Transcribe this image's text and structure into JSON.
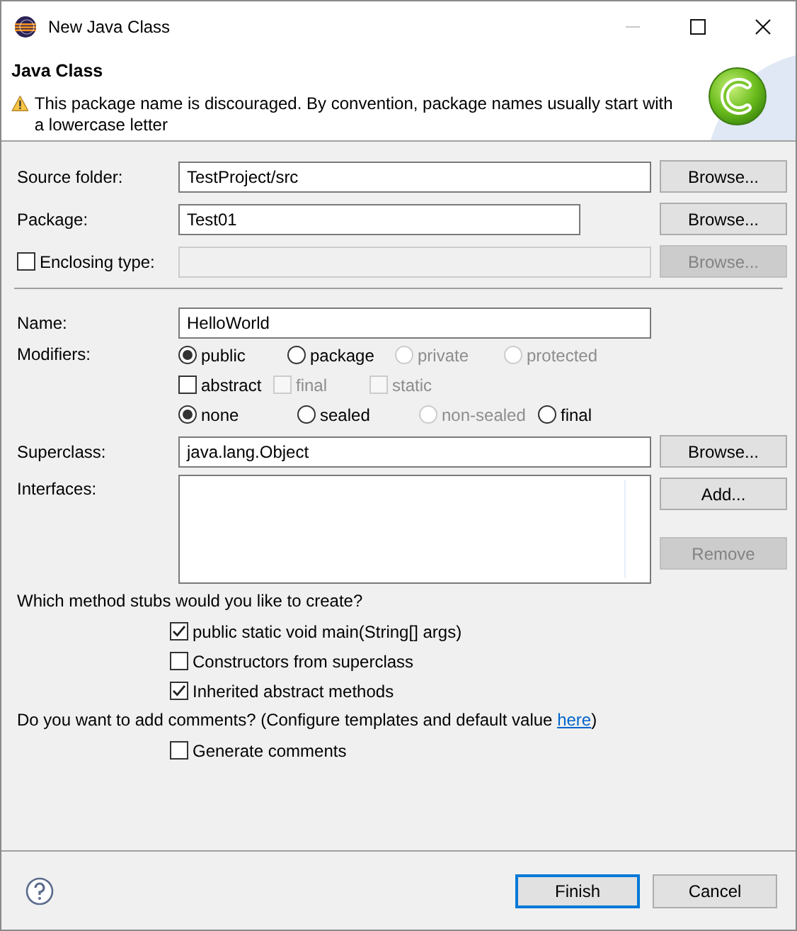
{
  "window": {
    "title": "New Java Class"
  },
  "header": {
    "title": "Java Class",
    "kind": "warning",
    "message": "This package name is discouraged. By convention, package names usually start with a lowercase letter"
  },
  "fields": [
    {
      "kind": "text",
      "label": "Source folder:",
      "value": "TestProject/src",
      "button": {
        "label": "Browse...",
        "disabled": false
      }
    },
    {
      "kind": "text",
      "label": "Package:",
      "value": "Test01",
      "button": {
        "label": "Browse...",
        "disabled": false
      }
    },
    {
      "kind": "checkbox",
      "label": "Enclosing type:",
      "checked": false,
      "disabled": true,
      "button": {
        "label": "Browse...",
        "disabled": true
      }
    }
  ],
  "name": {
    "label": "Name:",
    "value": "HelloWorld"
  },
  "modifiers": {
    "label": "Modifiers:",
    "rows": [
      [
        {
          "kind": "radio",
          "label": "public",
          "selected": true,
          "disabled": false
        },
        {
          "kind": "radio",
          "label": "package",
          "selected": false,
          "disabled": false
        },
        {
          "kind": "radio",
          "label": "private",
          "selected": false,
          "disabled": true
        },
        {
          "kind": "radio",
          "label": "protected",
          "selected": false,
          "disabled": true
        }
      ],
      [
        {
          "kind": "checkbox",
          "label": "abstract",
          "checked": false,
          "disabled": false
        },
        {
          "kind": "checkbox",
          "label": "final",
          "checked": false,
          "disabled": true
        },
        {
          "kind": "checkbox",
          "label": "static",
          "checked": false,
          "disabled": true
        }
      ],
      [
        {
          "kind": "radio",
          "label": "none",
          "selected": true,
          "disabled": false
        },
        {
          "kind": "radio",
          "label": "sealed",
          "selected": false,
          "disabled": false
        },
        {
          "kind": "radio",
          "label": "non-sealed",
          "selected": false,
          "disabled": true
        },
        {
          "kind": "radio",
          "label": "final",
          "selected": false,
          "disabled": false
        }
      ]
    ]
  },
  "superclass": {
    "label": "Superclass:",
    "value": "java.lang.Object",
    "button": {
      "label": "Browse...",
      "disabled": false
    }
  },
  "interfaces": {
    "label": "Interfaces:",
    "buttons": [
      {
        "label": "Add...",
        "disabled": false
      },
      {
        "label": "Remove",
        "disabled": true
      }
    ]
  },
  "method_stubs": {
    "question": "Which method stubs would you like to create?",
    "options": [
      {
        "label": "public static void main(String[] args)",
        "checked": true
      },
      {
        "label": "Constructors from superclass",
        "checked": false
      },
      {
        "label": "Inherited abstract methods",
        "checked": true
      }
    ]
  },
  "comments": {
    "question": "Do you want to add comments? (Configure templates and default value ",
    "link": "here",
    "question_end": ")",
    "options": [
      {
        "label": "Generate comments",
        "checked": false
      }
    ]
  },
  "footer": {
    "buttons": [
      {
        "label": "Finish",
        "default": true
      },
      {
        "label": "Cancel",
        "default": false
      }
    ]
  }
}
